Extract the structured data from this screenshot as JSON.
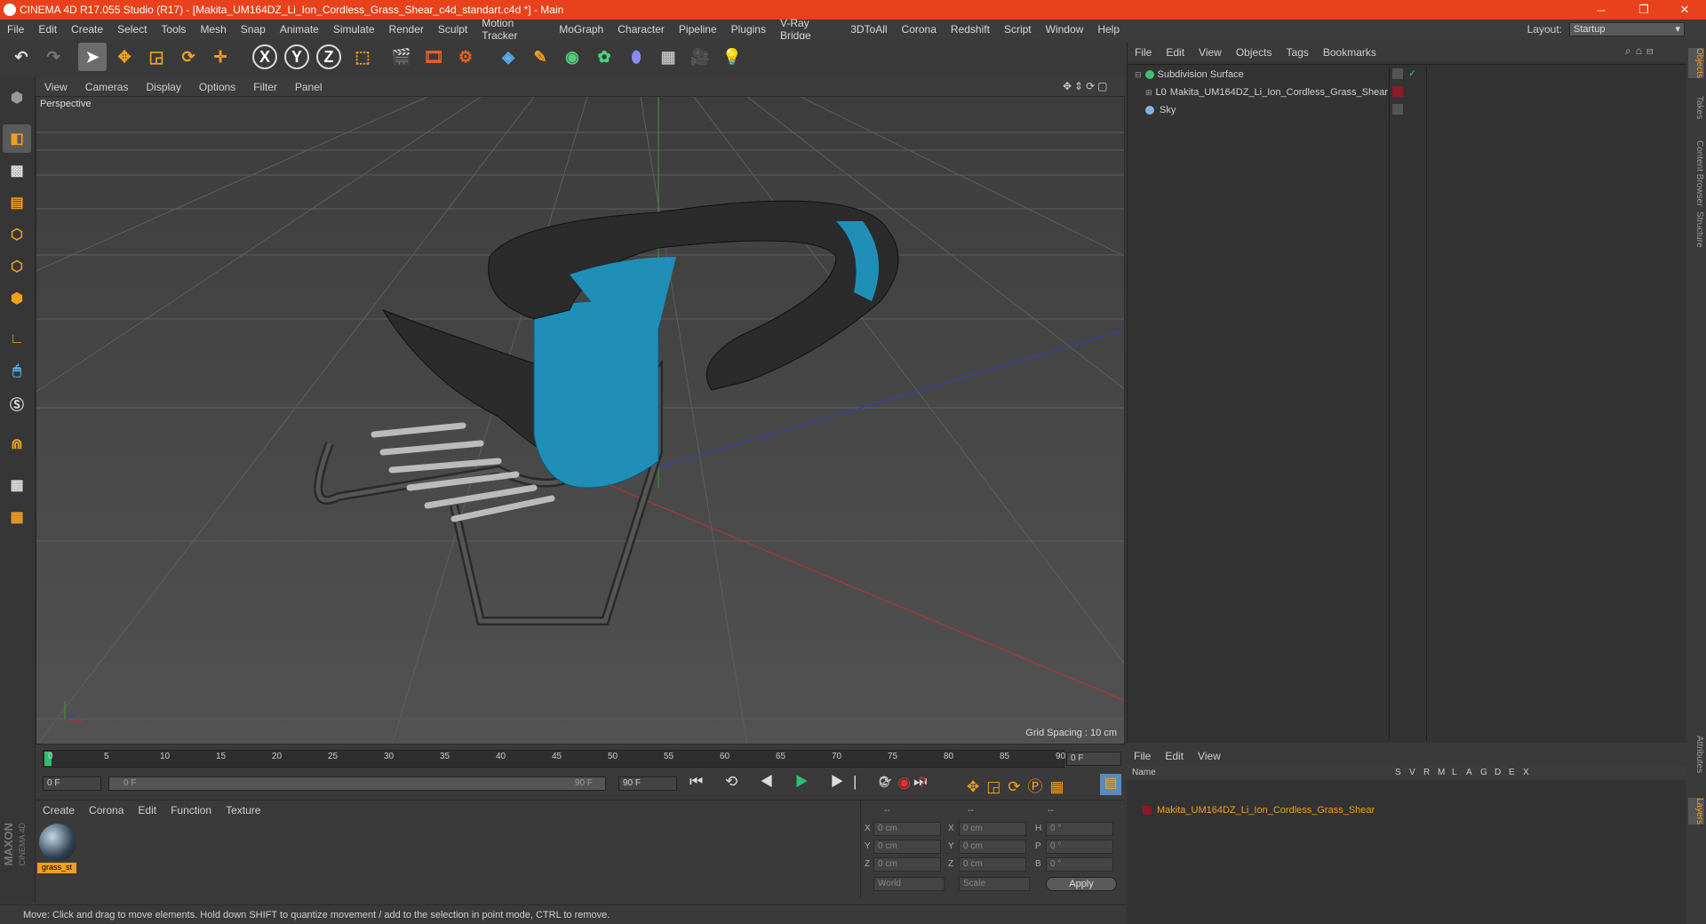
{
  "window": {
    "title": "CINEMA 4D R17.055 Studio (R17) - [Makita_UM164DZ_Li_Ion_Cordless_Grass_Shear_c4d_standart.c4d *] - Main",
    "min": "─",
    "max": "❐",
    "close": "✕"
  },
  "menu": [
    "File",
    "Edit",
    "Create",
    "Select",
    "Tools",
    "Mesh",
    "Snap",
    "Animate",
    "Simulate",
    "Render",
    "Sculpt",
    "Motion Tracker",
    "MoGraph",
    "Character",
    "Pipeline",
    "Plugins",
    "V-Ray Bridge",
    "3DToAll",
    "Corona",
    "Redshift",
    "Script",
    "Window",
    "Help"
  ],
  "layout": {
    "label": "Layout:",
    "value": "Startup"
  },
  "toolbar": {
    "x": "X",
    "y": "Y",
    "z": "Z"
  },
  "viewport": {
    "menu": [
      "View",
      "Cameras",
      "Display",
      "Options",
      "Filter",
      "Panel"
    ],
    "label": "Perspective",
    "grid": "Grid Spacing : 10 cm"
  },
  "timeline": {
    "ticks": [
      "0",
      "5",
      "10",
      "15",
      "20",
      "25",
      "30",
      "35",
      "40",
      "45",
      "50",
      "55",
      "60",
      "65",
      "70",
      "75",
      "80",
      "85",
      "90"
    ],
    "frame": "0 F",
    "start": "0 F",
    "range_start": "0 F",
    "range_end": "90 F",
    "end": "90 F"
  },
  "materials": {
    "menu": [
      "Create",
      "Corona",
      "Edit",
      "Function",
      "Texture"
    ],
    "item": "grass_st"
  },
  "coords": {
    "head": [
      "--",
      "--",
      "--"
    ],
    "pos": [
      "X",
      "Y",
      "Z"
    ],
    "size": [
      "X",
      "Y",
      "Z"
    ],
    "rot": [
      "H",
      "P",
      "B"
    ],
    "val": "0 cm",
    "deg": "0 °",
    "world": "World",
    "scale": "Scale",
    "apply": "Apply"
  },
  "objects": {
    "menu": [
      "File",
      "Edit",
      "View",
      "Objects",
      "Tags",
      "Bookmarks"
    ],
    "items": [
      "Subdivision Surface",
      "Makita_UM164DZ_Li_Ion_Cordless_Grass_Shear",
      "Sky"
    ]
  },
  "layers": {
    "menu": [
      "File",
      "Edit",
      "View"
    ],
    "name_col": "Name",
    "cols": [
      "S",
      "V",
      "R",
      "M",
      "L",
      "A",
      "G",
      "D",
      "E",
      "X"
    ],
    "item": "Makita_UM164DZ_Li_Ion_Cordless_Grass_Shear"
  },
  "rtabs": [
    "Objects",
    "Takes",
    "Content Browser",
    "Structure",
    "Attributes",
    "Layers"
  ],
  "status": "Move: Click and drag to move elements. Hold down SHIFT to quantize movement / add to the selection in point mode, CTRL to remove.",
  "brand": {
    "maxon": "MAXON",
    "c4d": "CINEMA 4D"
  }
}
